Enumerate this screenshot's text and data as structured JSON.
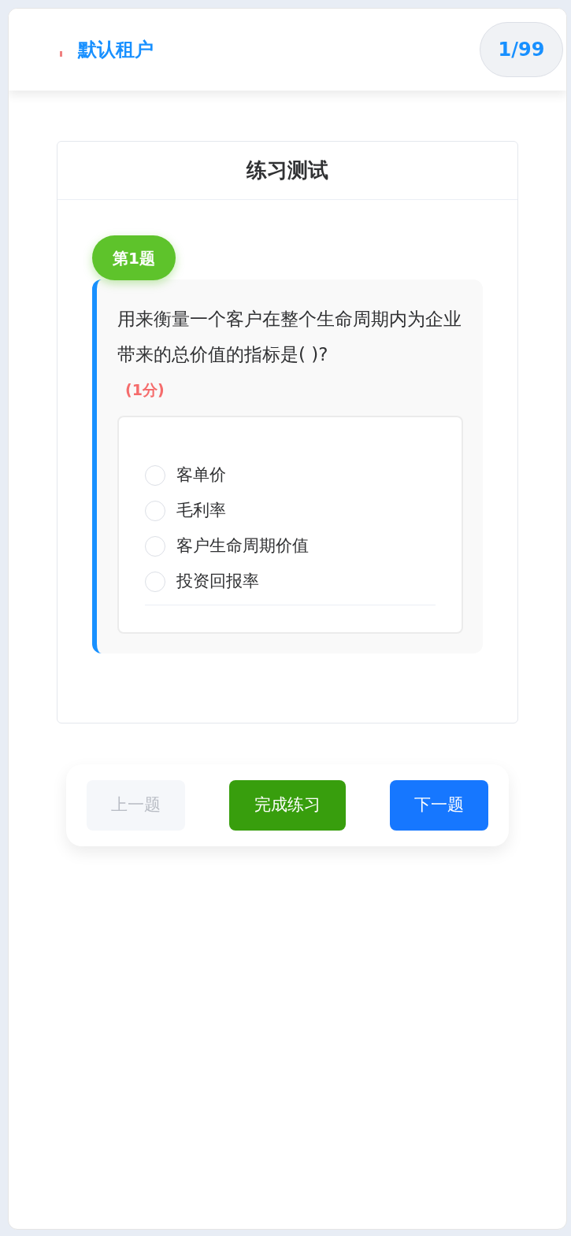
{
  "header": {
    "tenant": "默认租户",
    "progress": "1/99"
  },
  "card": {
    "title": "练习测试"
  },
  "question": {
    "badge": "第1题",
    "text": "用来衡量一个客户在整个生命周期内为企业带来的总价值的指标是(  )?",
    "score": "(1分)",
    "options": [
      {
        "label": "客单价",
        "checked": false
      },
      {
        "label": "毛利率",
        "checked": false
      },
      {
        "label": "客户生命周期价值",
        "checked": false
      },
      {
        "label": "投资回报率",
        "checked": false
      }
    ]
  },
  "buttons": [
    {
      "label": "上一题",
      "kind": "prev",
      "disabled": true
    },
    {
      "label": "完成练习",
      "kind": "finish",
      "disabled": false
    },
    {
      "label": "下一题",
      "kind": "next",
      "disabled": false
    }
  ]
}
